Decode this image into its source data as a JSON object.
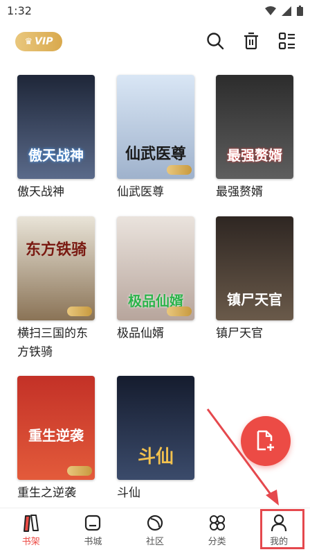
{
  "status": {
    "time": "1:32",
    "icons": [
      "wifi-icon",
      "signal-icon",
      "battery-icon"
    ]
  },
  "header": {
    "vip_label": "VIP",
    "icons": [
      "search-icon",
      "delete-icon",
      "list-icon"
    ]
  },
  "books": [
    {
      "title": "傲天战神",
      "cover_text": "傲天战神",
      "vip": false,
      "colors": [
        "#1e2638",
        "#5a6a8a"
      ]
    },
    {
      "title": "仙武医尊",
      "cover_text": "仙武医尊",
      "vip": true,
      "colors": [
        "#d9e6f5",
        "#9fb2cc"
      ]
    },
    {
      "title": "最强赘婿",
      "cover_text": "最强赘婿",
      "vip": false,
      "colors": [
        "#2c2c2c",
        "#5e5e5e"
      ]
    },
    {
      "title": "横扫三国的东方铁骑",
      "cover_text": "东方铁骑",
      "vip": true,
      "colors": [
        "#e9e4d8",
        "#8a7356"
      ]
    },
    {
      "title": "极品仙婿",
      "cover_text": "极品仙婿",
      "vip": true,
      "colors": [
        "#eae3dd",
        "#b7a59c"
      ]
    },
    {
      "title": "镇尸天官",
      "cover_text": "镇尸天官",
      "vip": false,
      "colors": [
        "#2e2622",
        "#6a5a4a"
      ]
    },
    {
      "title": "重生之逆袭",
      "cover_text": "重生逆袭",
      "vip": true,
      "colors": [
        "#c33127",
        "#e35b3b"
      ]
    },
    {
      "title": "斗仙",
      "cover_text": "斗仙",
      "vip": false,
      "colors": [
        "#151c2e",
        "#3b4b6b"
      ]
    }
  ],
  "fab": {
    "icon": "add-file-icon",
    "color": "#ec4b45"
  },
  "nav": [
    {
      "label": "书架",
      "icon": "bookshelf-icon",
      "active": true
    },
    {
      "label": "书城",
      "icon": "bookstore-icon",
      "active": false
    },
    {
      "label": "社区",
      "icon": "community-icon",
      "active": false
    },
    {
      "label": "分类",
      "icon": "category-icon",
      "active": false
    },
    {
      "label": "我的",
      "icon": "profile-icon",
      "active": false
    }
  ]
}
